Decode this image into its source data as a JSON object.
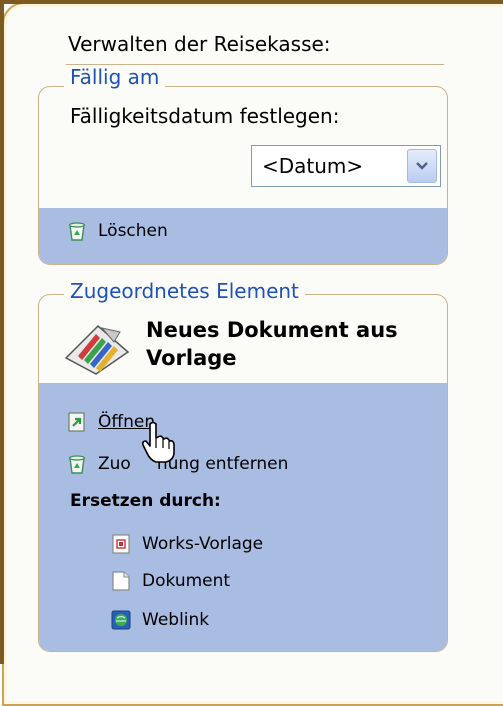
{
  "pane": {
    "heading": "Verwalten der Reisekasse:"
  },
  "due": {
    "legend": "Fällig am",
    "label": "Fälligkeitsdatum festlegen:",
    "date_value": "<Datum>",
    "delete_label": "Löschen"
  },
  "assigned": {
    "legend": "Zugeordnetes Element",
    "doc_title_line1": "Neues Dokument aus",
    "doc_title_line2": "Vorlage",
    "open_label": "Öffnen",
    "remove_prefix": "Zuo",
    "remove_suffix": "nung entfernen",
    "replace_heading": "Ersetzen durch:",
    "options": [
      {
        "label": "Works-Vorlage",
        "icon": "works-template-icon"
      },
      {
        "label": "Dokument",
        "icon": "document-icon"
      },
      {
        "label": "Weblink",
        "icon": "weblink-icon"
      }
    ]
  },
  "colors": {
    "accent_blue": "#1f52b8",
    "panel_blue": "#a9bde3",
    "frame": "#c8a35a"
  }
}
